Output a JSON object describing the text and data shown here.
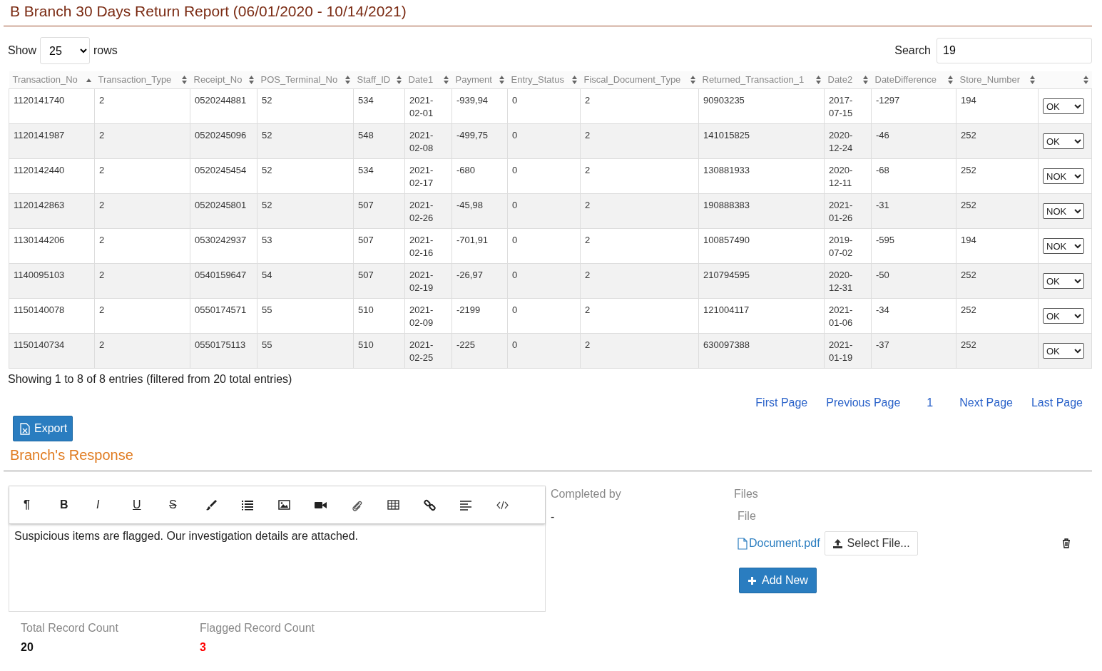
{
  "title": "B Branch 30 Days Return Report (06/01/2020 - 10/14/2021)",
  "length_control": {
    "show_label": "Show",
    "value": "25",
    "rows_label": "rows"
  },
  "search": {
    "label": "Search",
    "value": "19"
  },
  "table": {
    "columns": [
      {
        "label": "Transaction_No",
        "sorted": true
      },
      {
        "label": "Transaction_Type",
        "sorted": false
      },
      {
        "label": "Receipt_No",
        "sorted": false
      },
      {
        "label": "POS_Terminal_No",
        "sorted": false
      },
      {
        "label": "Staff_ID",
        "sorted": false
      },
      {
        "label": "Date1",
        "sorted": false
      },
      {
        "label": "Payment",
        "sorted": false
      },
      {
        "label": "Entry_Status",
        "sorted": false
      },
      {
        "label": "Fiscal_Document_Type",
        "sorted": false
      },
      {
        "label": "Returned_Transaction_1",
        "sorted": false
      },
      {
        "label": "Date2",
        "sorted": false
      },
      {
        "label": "DateDifference",
        "sorted": false
      },
      {
        "label": "Store_Number",
        "sorted": false
      },
      {
        "sorted": false
      }
    ],
    "rows": [
      {
        "cells": [
          "1120141740",
          "2",
          "0520244881",
          "52",
          "534",
          "2021-02-01",
          "-939,94",
          "0",
          "2",
          "90903235",
          "2017-07-15",
          "-1297",
          "194"
        ],
        "status": "OK"
      },
      {
        "cells": [
          "1120141987",
          "2",
          "0520245096",
          "52",
          "548",
          "2021-02-08",
          "-499,75",
          "0",
          "2",
          "141015825",
          "2020-12-24",
          "-46",
          "252"
        ],
        "status": "OK"
      },
      {
        "cells": [
          "1120142440",
          "2",
          "0520245454",
          "52",
          "534",
          "2021-02-17",
          "-680",
          "0",
          "2",
          "130881933",
          "2020-12-11",
          "-68",
          "252"
        ],
        "status": "NOK"
      },
      {
        "cells": [
          "1120142863",
          "2",
          "0520245801",
          "52",
          "507",
          "2021-02-26",
          "-45,98",
          "0",
          "2",
          "190888383",
          "2021-01-26",
          "-31",
          "252"
        ],
        "status": "NOK"
      },
      {
        "cells": [
          "1130144206",
          "2",
          "0530242937",
          "53",
          "507",
          "2021-02-16",
          "-701,91",
          "0",
          "2",
          "100857490",
          "2019-07-02",
          "-595",
          "194"
        ],
        "status": "NOK"
      },
      {
        "cells": [
          "1140095103",
          "2",
          "0540159647",
          "54",
          "507",
          "2021-02-19",
          "-26,97",
          "0",
          "2",
          "210794595",
          "2020-12-31",
          "-50",
          "252"
        ],
        "status": "OK"
      },
      {
        "cells": [
          "1150140078",
          "2",
          "0550174571",
          "55",
          "510",
          "2021-02-09",
          "-2199",
          "0",
          "2",
          "121004117",
          "2021-01-06",
          "-34",
          "252"
        ],
        "status": "OK"
      },
      {
        "cells": [
          "1150140734",
          "2",
          "0550175113",
          "55",
          "510",
          "2021-02-25",
          "-225",
          "0",
          "2",
          "630097388",
          "2021-01-19",
          "-37",
          "252"
        ],
        "status": "OK"
      }
    ]
  },
  "info": "Showing 1 to 8 of 8 entries (filtered from 20 total entries)",
  "pager": [
    {
      "label": "First Page",
      "kind": "link"
    },
    {
      "label": "Previous Page",
      "kind": "link"
    },
    {
      "label": "1",
      "kind": "page"
    },
    {
      "label": "Next Page",
      "kind": "link"
    },
    {
      "label": "Last Page",
      "kind": "link"
    }
  ],
  "export_button": "Export",
  "response": {
    "heading": "Branch's Response",
    "toolbar": [
      {
        "kind": "paragraph",
        "label": "¶"
      },
      {
        "kind": "bold",
        "label": "B"
      },
      {
        "kind": "italic",
        "label": "I"
      },
      {
        "kind": "underline",
        "label": "U"
      },
      {
        "kind": "strike",
        "label": "S"
      },
      {
        "kind": "brush"
      },
      {
        "kind": "list"
      },
      {
        "kind": "image"
      },
      {
        "kind": "video"
      },
      {
        "kind": "attach"
      },
      {
        "kind": "table"
      },
      {
        "kind": "link"
      },
      {
        "kind": "align"
      },
      {
        "kind": "code"
      }
    ],
    "text": "Suspicious items are flagged. Our investigation details are attached.",
    "completed_by_label": "Completed by",
    "completed_by_value": "-",
    "files_label": "Files",
    "file_label": "File",
    "file_name": "Document.pdf",
    "select_button": "Select File...",
    "add_button": "Add New",
    "counts": [
      {
        "label": "Total Record Count",
        "value": "20",
        "kind": "normal"
      },
      {
        "label": "Flagged Record Count",
        "value": "3",
        "kind": "alert"
      }
    ]
  }
}
